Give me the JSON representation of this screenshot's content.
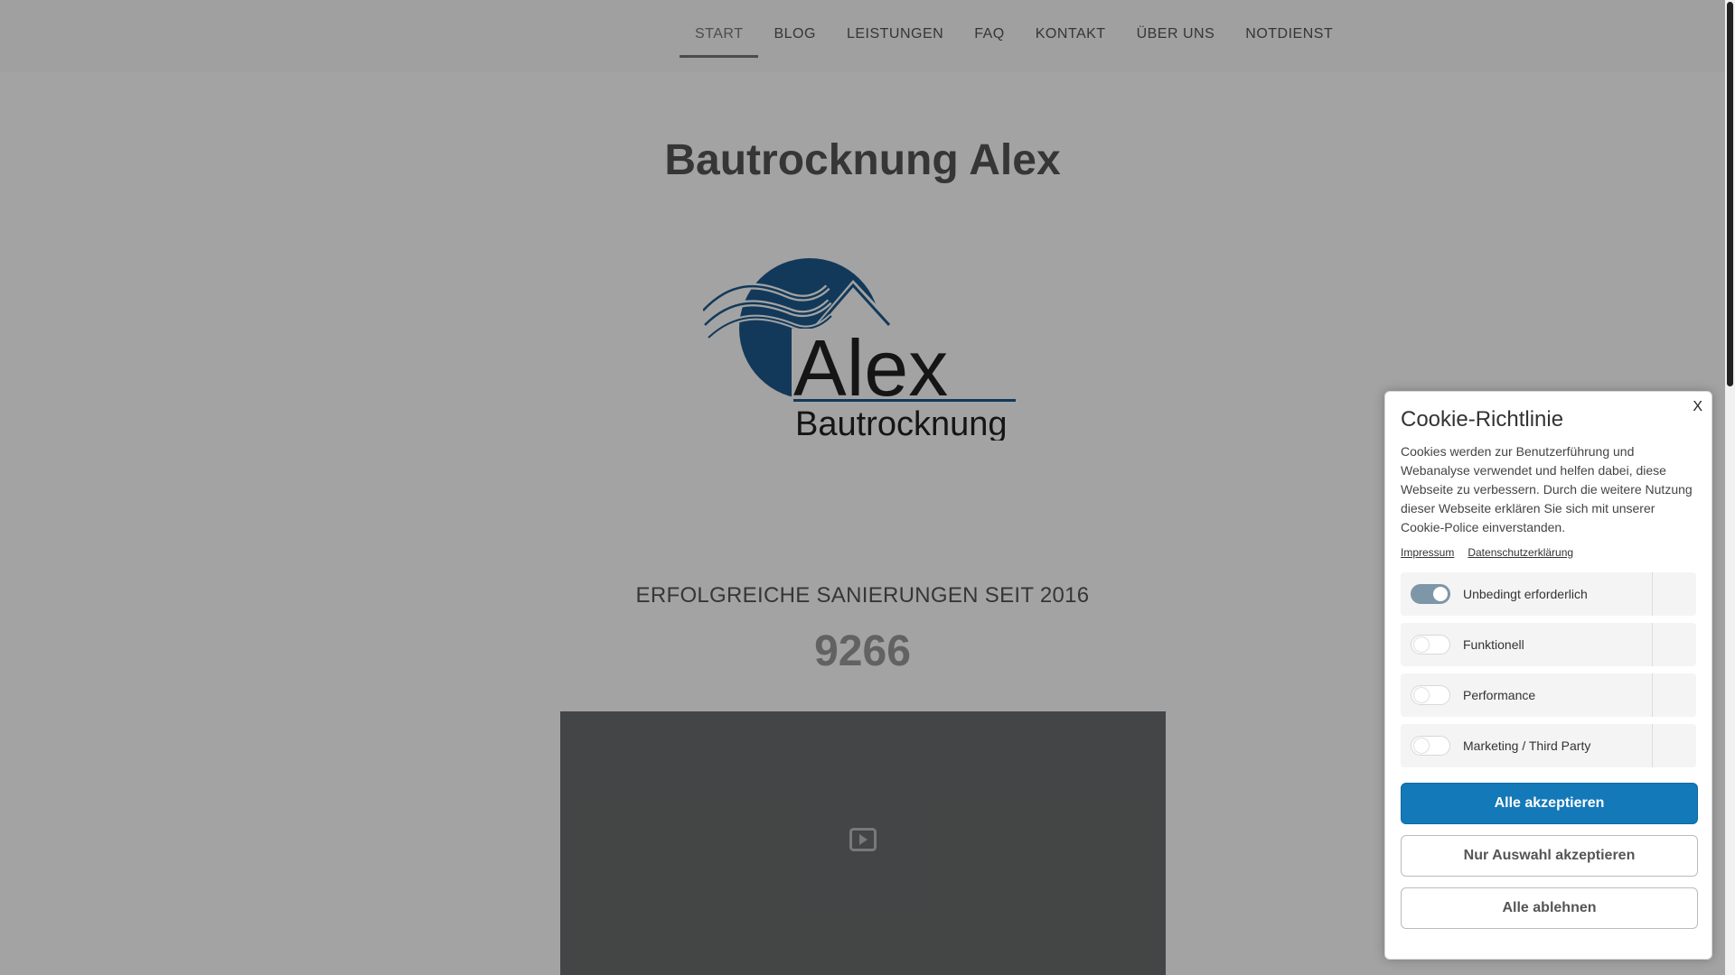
{
  "nav": {
    "items": [
      {
        "label": "START",
        "active": true
      },
      {
        "label": "BLOG"
      },
      {
        "label": "LEISTUNGEN"
      },
      {
        "label": "FAQ"
      },
      {
        "label": "KONTAKT"
      },
      {
        "label": "ÜBER UNS"
      },
      {
        "label": "NOTDIENST"
      }
    ]
  },
  "hero": {
    "title": "Bautrocknung Alex",
    "logo_text_main": "Alex",
    "logo_text_sub": "Bautrocknung"
  },
  "counter": {
    "label": "ERFOLGREICHE SANIERUNGEN SEIT 2016",
    "value": "9266"
  },
  "video": {
    "icon": "play-icon"
  },
  "cookie": {
    "close_label": "X",
    "title": "Cookie-Richtlinie",
    "text": "Cookies werden zur Benutzerführung und Webanalyse verwendet und helfen dabei, diese Webseite zu verbessern. Durch die weitere Nutzung dieser Webseite erklären Sie sich mit unserer Cookie-Police einverstanden.",
    "links": {
      "impressum": "Impressum",
      "privacy": "Datenschutzerklärung"
    },
    "options": [
      {
        "label": "Unbedingt erforderlich",
        "enabled": true
      },
      {
        "label": "Funktionell",
        "enabled": false
      },
      {
        "label": "Performance",
        "enabled": false
      },
      {
        "label": "Marketing / Third Party",
        "enabled": false
      }
    ],
    "buttons": {
      "accept_all": "Alle akzeptieren",
      "accept_selection": "Nur Auswahl akzeptieren",
      "reject_all": "Alle ablehnen"
    }
  },
  "colors": {
    "accent": "#1479b8",
    "logo_blue": "#1d5a8c",
    "toggle_on": "#7d97a9"
  }
}
